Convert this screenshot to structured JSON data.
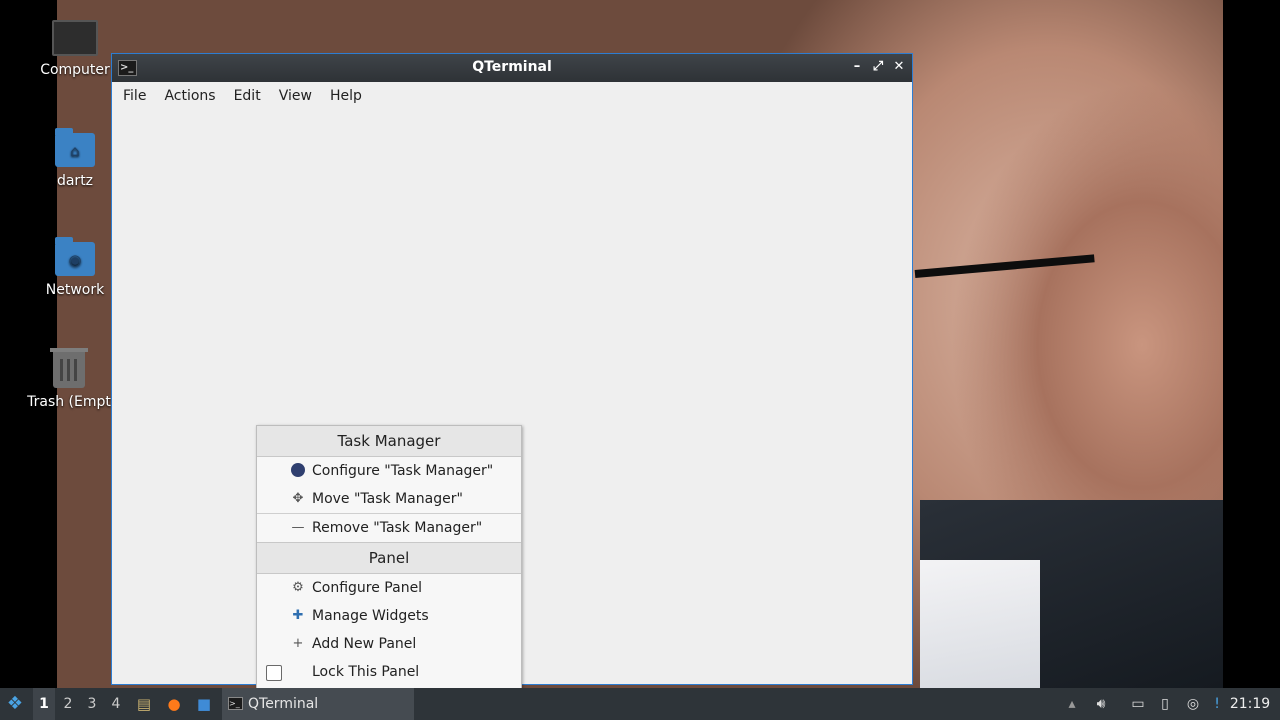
{
  "desktop": {
    "icons": [
      {
        "label": "Computer",
        "icon": "computer-icon"
      },
      {
        "label": "dartz",
        "icon": "home-folder-icon"
      },
      {
        "label": "Network",
        "icon": "network-folder-icon"
      },
      {
        "label": "Trash (Empt",
        "icon": "trash-icon"
      }
    ]
  },
  "window": {
    "title": "QTerminal",
    "app_icon": "terminal-icon",
    "controls": {
      "minimize": "–",
      "maximize": "⤢",
      "close": "✕"
    },
    "menu": [
      "File",
      "Actions",
      "Edit",
      "View",
      "Help"
    ]
  },
  "context_menu": {
    "section1": "Task Manager",
    "configure_task_manager": "Configure \"Task Manager\"",
    "move_task_manager": "Move \"Task Manager\"",
    "remove_task_manager": "Remove \"Task Manager\"",
    "section2": "Panel",
    "configure_panel": "Configure Panel",
    "manage_widgets": "Manage Widgets",
    "add_new_panel": "Add New Panel",
    "lock_panel": "Lock This Panel",
    "lock_panel_checked": false
  },
  "taskbar": {
    "workspaces": [
      "1",
      "2",
      "3",
      "4"
    ],
    "active_workspace": "1",
    "quicklaunch": [
      "file-manager-icon",
      "firefox-icon",
      "desktop-icon"
    ],
    "task_label": "QTerminal",
    "tray": [
      "panel-arrow-icon",
      "volume-icon",
      "screen-icon",
      "clipboard-icon",
      "update-icon",
      "notification-icon"
    ],
    "clock": "21:19"
  },
  "colors": {
    "accent": "#2d7dd2",
    "taskbar_bg": "#2e3439",
    "titlebar_bg": "#3f4449"
  }
}
